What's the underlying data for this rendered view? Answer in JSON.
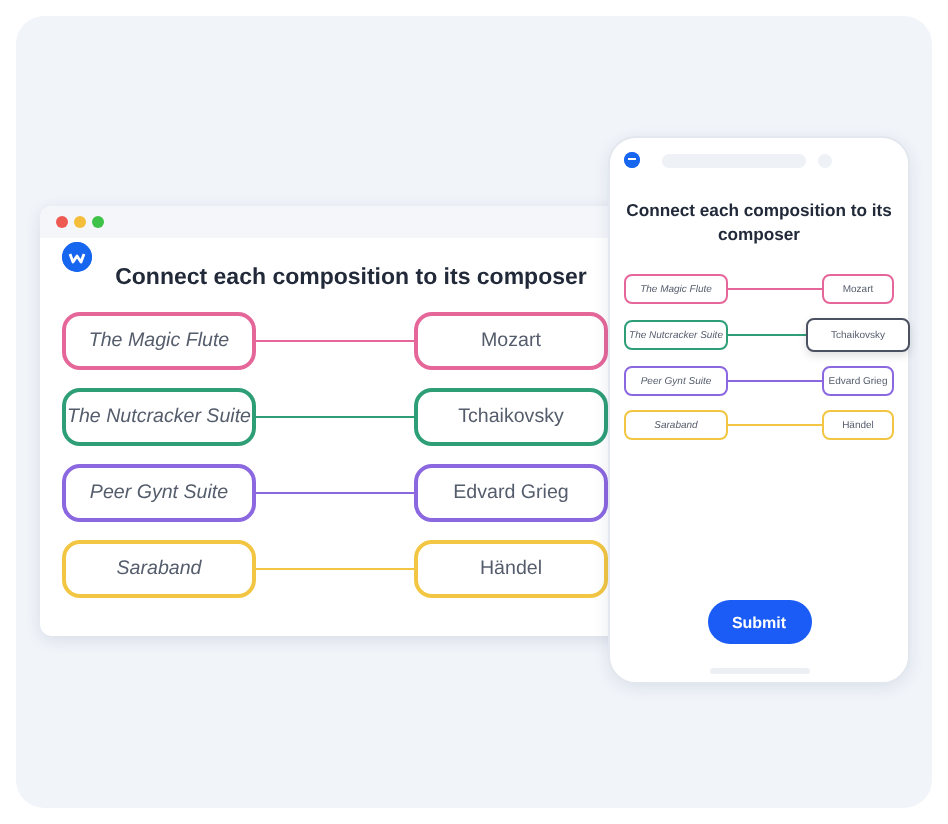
{
  "desktop": {
    "title": "Connect each composition to its composer",
    "pairs": [
      {
        "composition": "The Magic Flute",
        "composer": "Mozart",
        "color": "#e5679a"
      },
      {
        "composition": "The Nutcracker Suite",
        "composer": "Tchaikovsky",
        "color": "#2e9e77"
      },
      {
        "composition": "Peer Gynt Suite",
        "composer": "Edvard Grieg",
        "color": "#8b68e0"
      },
      {
        "composition": "Saraband",
        "composer": "Händel",
        "color": "#f2c643"
      }
    ]
  },
  "mobile": {
    "title": "Connect each composition to its composer",
    "pairs": [
      {
        "composition": "The Magic Flute",
        "composer": "Mozart",
        "color": "#e5679a",
        "selected": false
      },
      {
        "composition": "The Nutcracker Suite",
        "composer": "Tchaikovsky",
        "color": "#2e9e77",
        "selected": true
      },
      {
        "composition": "Peer Gynt Suite",
        "composer": "Edvard Grieg",
        "color": "#8b68e0",
        "selected": false
      },
      {
        "composition": "Saraband",
        "composer": "Händel",
        "color": "#f2c643",
        "selected": false
      }
    ],
    "submit": "Submit"
  }
}
